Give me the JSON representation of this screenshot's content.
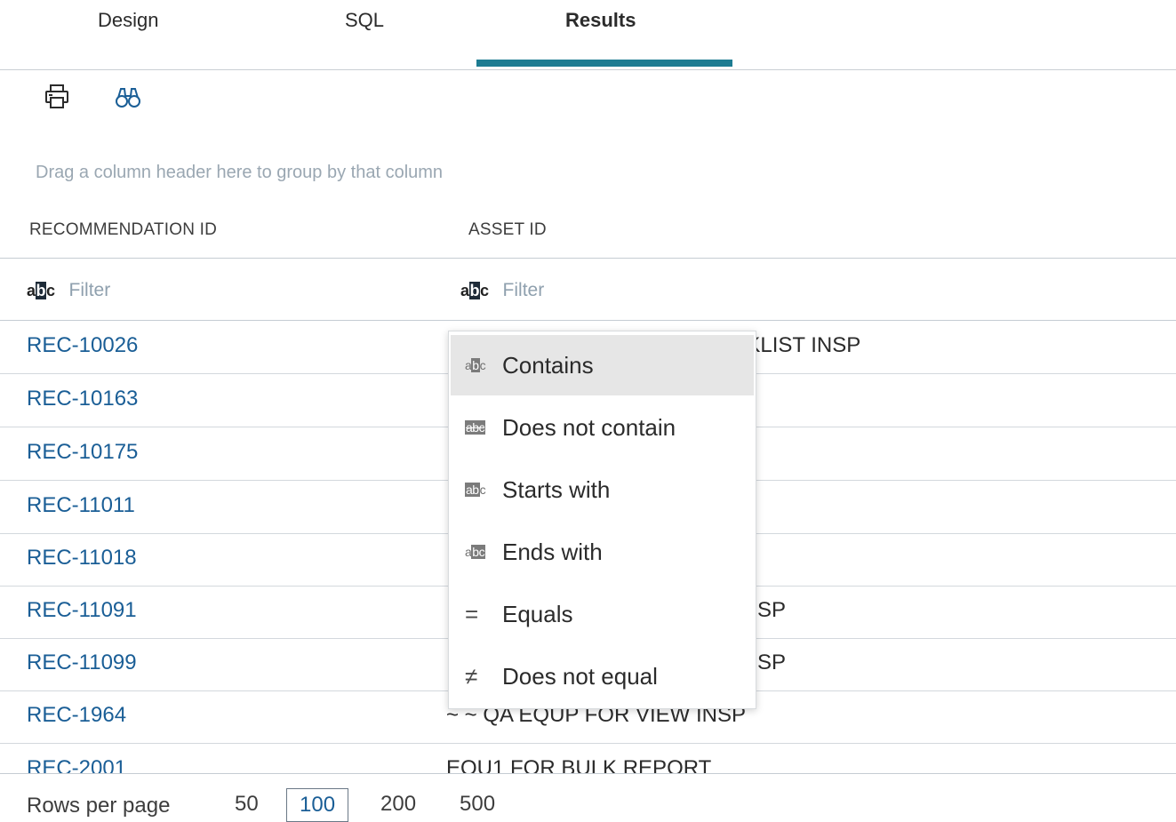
{
  "tabs": [
    {
      "label": "Design"
    },
    {
      "label": "SQL"
    },
    {
      "label": "Results",
      "active": true
    }
  ],
  "toolbar": {
    "print_icon": "print-icon",
    "find_icon": "binoculars-icon"
  },
  "group_hint": "Drag a column header here to group by that column",
  "columns": [
    {
      "header": "RECOMMENDATION ID",
      "filter_placeholder": "Filter"
    },
    {
      "header": "ASSET ID",
      "filter_placeholder": "Filter"
    }
  ],
  "rows": [
    {
      "id": "REC-10026",
      "asset": "CKLIST INSP"
    },
    {
      "id": "REC-10163",
      "asset": ""
    },
    {
      "id": "REC-10175",
      "asset": ""
    },
    {
      "id": "REC-11011",
      "asset": ""
    },
    {
      "id": "REC-11018",
      "asset": ""
    },
    {
      "id": "REC-11091",
      "asset": "SP"
    },
    {
      "id": "REC-11099",
      "asset": "SP"
    },
    {
      "id": "REC-1964",
      "asset": "~ ~ QA EQUP FOR VIEW INSP"
    },
    {
      "id": "REC-2001",
      "asset": "EQU1 FOR BULK REPORT"
    }
  ],
  "filter_menu": {
    "selected": "Contains",
    "items": [
      {
        "label": "Contains",
        "icon": "contains-icon"
      },
      {
        "label": "Does not contain",
        "icon": "does-not-contain-icon"
      },
      {
        "label": "Starts with",
        "icon": "starts-with-icon"
      },
      {
        "label": "Ends with",
        "icon": "ends-with-icon"
      },
      {
        "label": "Equals",
        "icon": "equals-icon"
      },
      {
        "label": "Does not equal",
        "icon": "not-equal-icon"
      }
    ]
  },
  "footer": {
    "rows_per_page_label": "Rows per page",
    "options": [
      "50",
      "100",
      "200",
      "500"
    ],
    "selected": "100"
  },
  "colors": {
    "accent": "#1d7c92",
    "link": "#1a5e96"
  }
}
